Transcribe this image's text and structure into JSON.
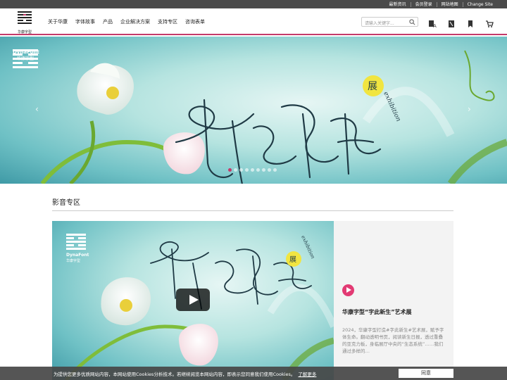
{
  "topbar": {
    "links": [
      "最新资讯",
      "会员登录",
      "网站地图",
      "Change Site"
    ]
  },
  "header": {
    "logo_text": "华康字型",
    "nav": [
      "关于华康",
      "字体故事",
      "产品",
      "企业解决方案",
      "支持专区",
      "咨询表单"
    ],
    "search_placeholder": "请输入关键字...",
    "icons": [
      "font-icon",
      "book-icon",
      "bookmark-icon",
      "cart-icon"
    ]
  },
  "banner": {
    "brand_en": "DynaFont",
    "brand_cn": "华康字型",
    "title": "字此新生",
    "badge": "展",
    "script": "exhibition",
    "slides": 9,
    "active_slide": 0,
    "prev": "‹",
    "next": "›"
  },
  "section": {
    "title": "影音专区"
  },
  "video": {
    "brand_en": "DynaFont",
    "brand_cn": "华康字型",
    "title": "字此新生",
    "badge": "展",
    "script": "exhibition"
  },
  "info": {
    "title": "华康字型“字此新生”艺术展",
    "desc": "2024，华康字型打造#字此新生#艺术展，赋予字体生命。翻动透明书页，阅读新生日报，透过重叠的亚克力板，身临展厅中央的“生态系统”……我们通过多样的…"
  },
  "cookie": {
    "text": "为提供您更多优质网站内容，本网站使用Cookies分析技术。若继续阅览本网站内容，即表示您同意我们使用Cookies。",
    "link": "了解更多",
    "button": "同意"
  },
  "colors": {
    "accent": "#c43a6a",
    "play": "#e23a73",
    "topbar": "#4a4a4a"
  }
}
